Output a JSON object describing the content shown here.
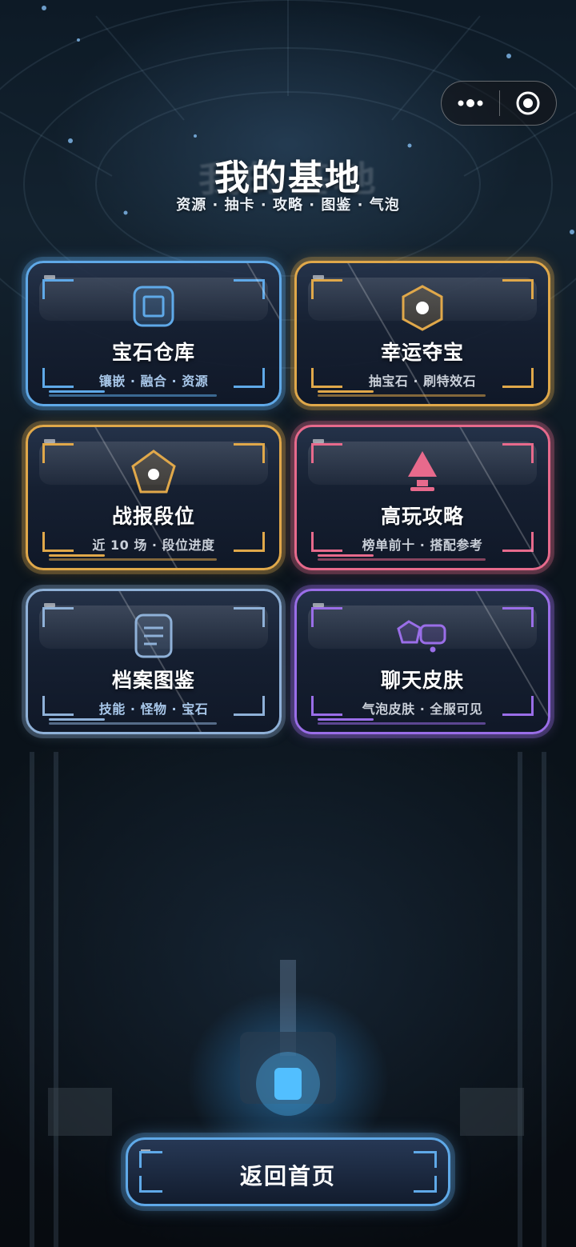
{
  "header": {
    "title": "我的基地",
    "subtitle": "资源 · 抽卡 · 攻略 · 图鉴 · 气泡"
  },
  "capsule": {
    "more_icon": "more-dots-icon",
    "close_icon": "target-circle-icon"
  },
  "cards": [
    {
      "title": "宝石仓库",
      "subtitle": "镶嵌 · 融合 · 资源",
      "icon": "square-icon",
      "accent": "#5fa9e8"
    },
    {
      "title": "幸运夺宝",
      "subtitle": "抽宝石 · 刷特效石",
      "icon": "hexagon-icon",
      "accent": "#e0a84a"
    },
    {
      "title": "战报段位",
      "subtitle": "近 10 场 · 段位进度",
      "icon": "pentagon-icon",
      "accent": "#e0a84a"
    },
    {
      "title": "高玩攻略",
      "subtitle": "榜单前十 · 搭配参考",
      "icon": "triangle-pedestal-icon",
      "accent": "#e76a8c"
    },
    {
      "title": "档案图鉴",
      "subtitle": "技能 · 怪物 · 宝石",
      "icon": "document-icon",
      "accent": "#8fb1d8"
    },
    {
      "title": "聊天皮肤",
      "subtitle": "气泡皮肤 · 全服可见",
      "icon": "chat-bubble-icon",
      "accent": "#9a6ee8"
    }
  ],
  "back_button": {
    "label": "返回首页"
  }
}
